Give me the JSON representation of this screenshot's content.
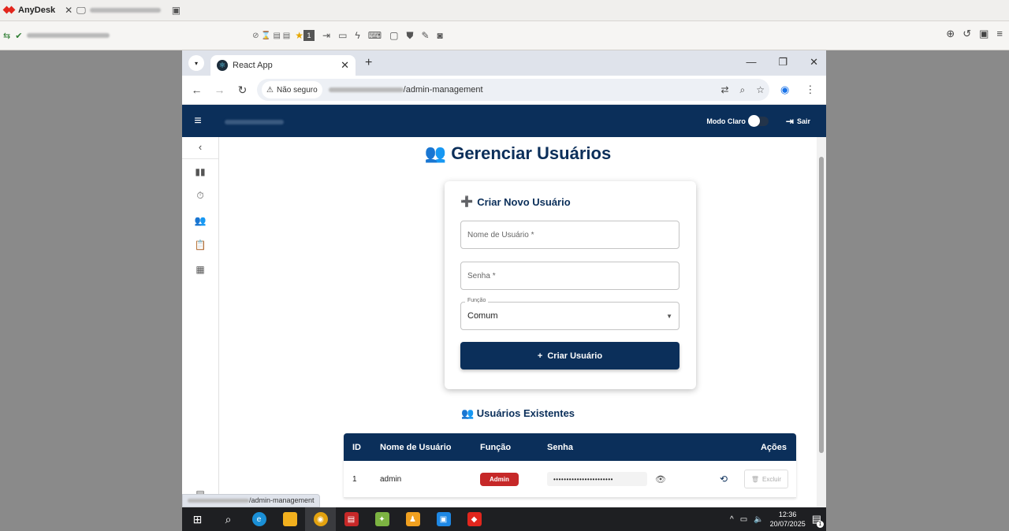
{
  "anydesk": {
    "app_name": "AnyDesk",
    "session_tab_label": "",
    "toolbar_badge": "1"
  },
  "browser": {
    "tab_title": "React App",
    "security_label": "Não seguro",
    "url_path": "/admin-management",
    "status_url_path": "/admin-management"
  },
  "app": {
    "theme_label": "Modo Claro",
    "logout_label": "Sair",
    "page_title": "Gerenciar Usuários",
    "form": {
      "title": "Criar Novo Usuário",
      "username_placeholder": "Nome de Usuário *",
      "password_placeholder": "Senha *",
      "role_label": "Função",
      "role_value": "Comum",
      "create_button": "Criar Usuário"
    },
    "existing_title": "Usuários Existentes",
    "table": {
      "headers": {
        "id": "ID",
        "name": "Nome de Usuário",
        "role": "Função",
        "password": "Senha",
        "actions": "Ações"
      },
      "rows": [
        {
          "id": "1",
          "name": "admin",
          "role": "Admin",
          "password": "•••••••••••••••••••••••",
          "delete_label": "Excluir"
        }
      ]
    }
  },
  "taskbar": {
    "time": "12:36",
    "date": "20/07/2025",
    "notif_count": "1"
  },
  "colors": {
    "primary": "#0b2f5a",
    "admin_badge": "#c62828",
    "anydesk_red": "#e2261d"
  }
}
